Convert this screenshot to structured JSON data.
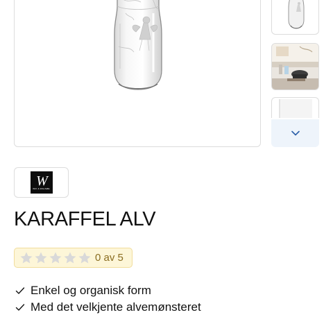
{
  "product": {
    "title": "KARAFFEL ALV",
    "main_image": "carafe-glass-fairy-image",
    "brand": {
      "logo_monogram": "W",
      "logo_text": "WIK & WALSØE"
    }
  },
  "gallery": {
    "thumbnails": [
      {
        "image": "carafe-thumbnail"
      },
      {
        "image": "interior-table-scene-thumbnail"
      },
      {
        "image": "partial-thumbnail"
      }
    ],
    "scroll_icon": "chevron-down-icon"
  },
  "rating": {
    "stars_filled": 0,
    "stars_total": 5,
    "text": "0 av 5",
    "star_color": "#d9d9d9",
    "text_color": "#8a6d20"
  },
  "features": [
    {
      "icon": "check-icon",
      "text": "Enkel og organisk form"
    },
    {
      "icon": "check-icon",
      "text": "Med det velkjente alvemønsteret"
    }
  ],
  "colors": {
    "accent_light": "#eef4fb",
    "accent": "#2b5fa8",
    "border": "#dcdcdc",
    "rating_bg": "#fdf6d8"
  }
}
